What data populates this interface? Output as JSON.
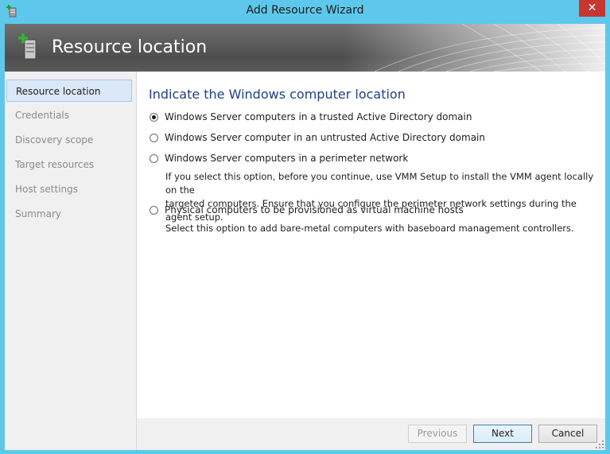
{
  "window": {
    "title": "Add Resource Wizard",
    "close_glyph": "✕",
    "icon": "wizard-server-icon"
  },
  "banner": {
    "title": "Resource location",
    "icon": "server-add-icon"
  },
  "sidebar": {
    "items": [
      {
        "label": "Resource location",
        "active": true
      },
      {
        "label": "Credentials",
        "active": false
      },
      {
        "label": "Discovery scope",
        "active": false
      },
      {
        "label": "Target resources",
        "active": false
      },
      {
        "label": "Host settings",
        "active": false
      },
      {
        "label": "Summary",
        "active": false
      }
    ]
  },
  "main": {
    "heading": "Indicate the Windows computer location",
    "options": [
      {
        "label": "Windows Server computers in a trusted Active Directory domain",
        "checked": true
      },
      {
        "label": "Windows Server computer in an untrusted Active Directory domain",
        "checked": false
      },
      {
        "label": "Windows Server computers in a perimeter network",
        "checked": false
      },
      {
        "label": "Physical computers to be provisioned as virtual machine hosts",
        "checked": false
      }
    ],
    "perimeter_note_line1": "If you select this option, before you continue, use VMM Setup to install the VMM agent locally on the",
    "perimeter_note_line2": "targeted computers. Ensure that you configure the perimeter network settings during the agent setup.",
    "physical_note": "Select this option to add bare-metal computers with baseboard management controllers."
  },
  "footer": {
    "previous_label": "Previous",
    "next_label": "Next",
    "cancel_label": "Cancel"
  },
  "colors": {
    "titlebar": "#5ec8ec",
    "close": "#c7372f",
    "heading": "#203f85",
    "active_item_bg": "#dbe8f8"
  }
}
